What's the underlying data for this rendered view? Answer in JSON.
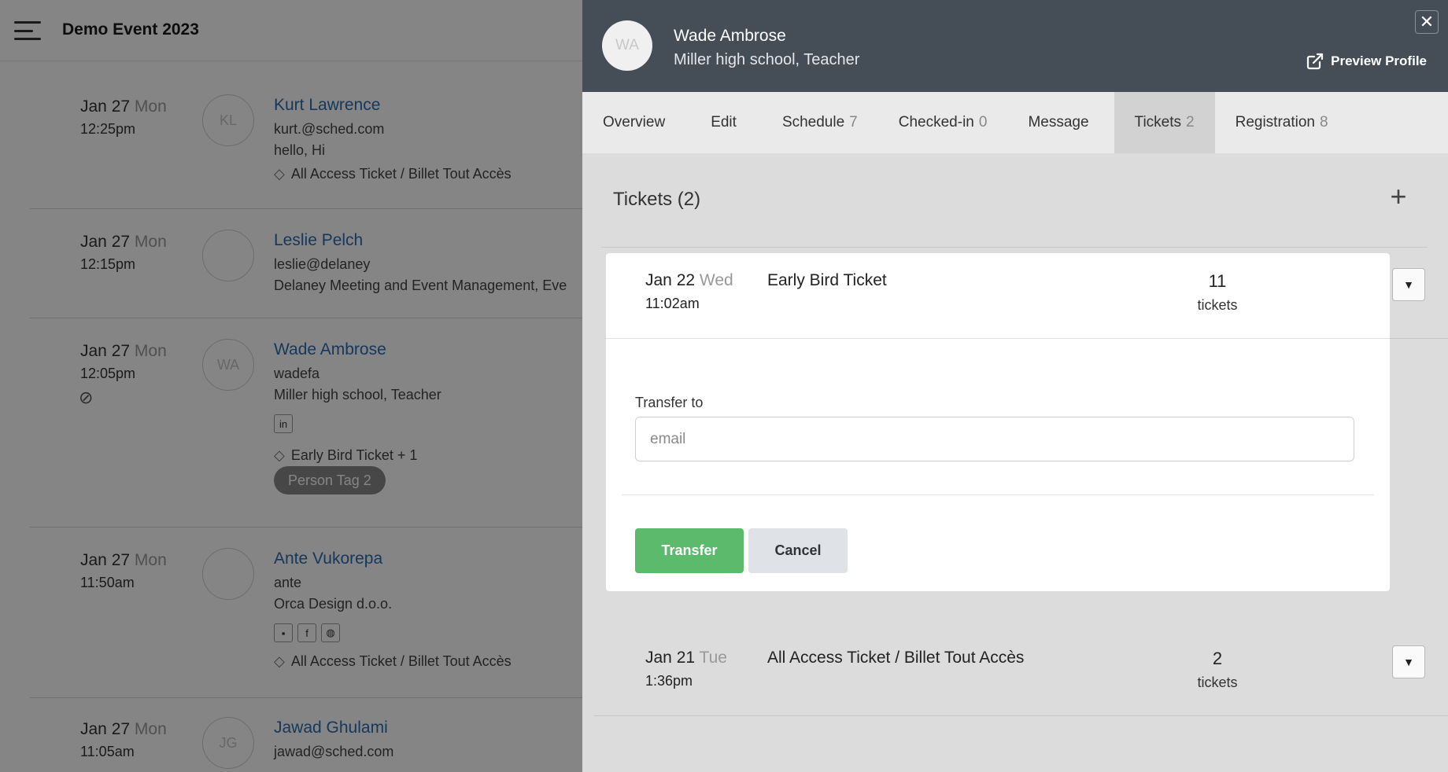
{
  "app": {
    "event_title": "Demo Event 2023"
  },
  "attendees": [
    {
      "date": "Jan 27",
      "dow": "Mon",
      "time": "12:25pm",
      "initials": "KL",
      "name": "Kurt Lawrence",
      "line1": "kurt.@sched.com",
      "line2": "hello, Hi",
      "ticket": "All Access Ticket / Billet Tout Accès"
    },
    {
      "date": "Jan 27",
      "dow": "Mon",
      "time": "12:15pm",
      "name": "Leslie Pelch",
      "line1": "leslie@delaney",
      "line2": "Delaney Meeting and Event Management, Eve"
    },
    {
      "date": "Jan 27",
      "dow": "Mon",
      "time": "12:05pm",
      "initials": "WA",
      "name": "Wade Ambrose",
      "line1": "wadefa",
      "line2": "Miller high school, Teacher",
      "ticket": "Early Bird Ticket + 1",
      "tag": "Person Tag 2"
    },
    {
      "date": "Jan 27",
      "dow": "Mon",
      "time": "11:50am",
      "name": "Ante Vukorepa",
      "line1": "ante",
      "line2": "Orca Design d.o.o.",
      "ticket": "All Access Ticket / Billet Tout Accès"
    },
    {
      "date": "Jan 27",
      "dow": "Mon",
      "time": "11:05am",
      "initials": "JG",
      "name": "Jawad Ghulami",
      "line1": "jawad@sched.com"
    }
  ],
  "panel": {
    "initials": "WA",
    "name": "Wade Ambrose",
    "subtitle": "Miller high school, Teacher",
    "preview_label": "Preview Profile",
    "close_symbol": "✕",
    "tabs": [
      {
        "label": "Overview",
        "count": ""
      },
      {
        "label": "Edit",
        "count": ""
      },
      {
        "label": "Schedule",
        "count": "7"
      },
      {
        "label": "Checked-in",
        "count": "0"
      },
      {
        "label": "Message",
        "count": ""
      },
      {
        "label": "Tickets",
        "count": "2"
      },
      {
        "label": "Registration",
        "count": "8"
      }
    ],
    "active_tab": "Tickets"
  },
  "tickets": {
    "heading": "Tickets (2)",
    "add_symbol": "+",
    "items": [
      {
        "date": "Jan 22",
        "dow": "Wed",
        "time": "11:02am",
        "name": "Early Bird Ticket",
        "count": "11",
        "unit": "tickets"
      },
      {
        "date": "Jan 21",
        "dow": "Tue",
        "time": "1:36pm",
        "name": "All Access Ticket / Billet Tout Accès",
        "count": "2",
        "unit": "tickets"
      }
    ],
    "transfer": {
      "label": "Transfer to",
      "placeholder": "email",
      "value": "",
      "submit_label": "Transfer",
      "cancel_label": "Cancel"
    }
  },
  "colors": {
    "panel_header": "#454d57",
    "link": "#2b6cb0",
    "transfer_button": "#5cba6d",
    "active_tab": "#d2d2d2"
  },
  "icons": {
    "menu": "hamburger-icon",
    "close": "close-icon",
    "external": "external-link-icon",
    "ticket": "ticket-icon",
    "hidden": "eye-slash-icon",
    "caret": "caret-down-icon",
    "add": "plus-icon"
  }
}
